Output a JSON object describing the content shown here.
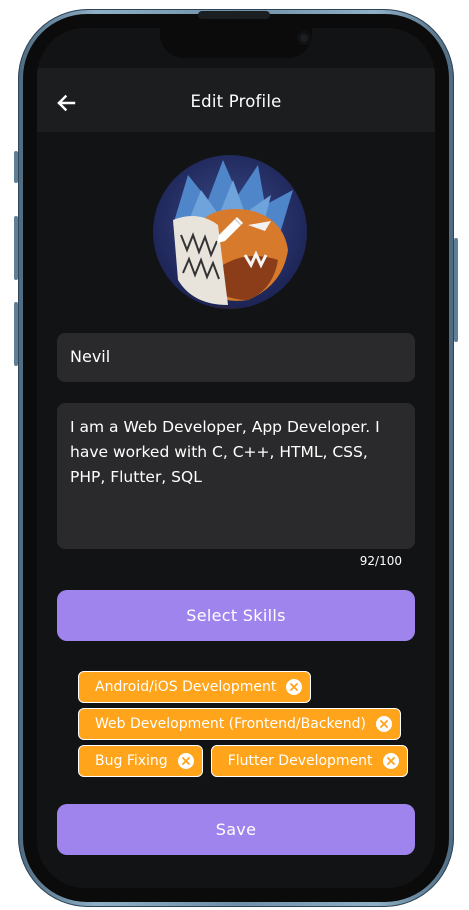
{
  "appbar": {
    "title": "Edit Profile",
    "back_icon": "arrow-left-icon"
  },
  "profile": {
    "avatar_icon": "profile-photo",
    "edit_icon": "pencil-icon",
    "name": "Nevil",
    "bio": "I am a Web Developer, App Developer. I have worked with C, C++, HTML, CSS, PHP, Flutter, SQL",
    "bio_counter": "92/100"
  },
  "skills": {
    "button_label": "Select Skills",
    "chips": [
      {
        "label": "Android/iOS Development"
      },
      {
        "label": "Web Development (Frontend/Backend)"
      },
      {
        "label": "Bug Fixing"
      },
      {
        "label": "Flutter Development"
      }
    ],
    "remove_icon": "close-circle-icon"
  },
  "actions": {
    "save_label": "Save"
  },
  "colors": {
    "background": "#121315",
    "appbar": "#1c1d1f",
    "field": "#2a2a2c",
    "primary_button": "#a084ee",
    "chip": "#ffa41b",
    "text": "#ffffff"
  }
}
